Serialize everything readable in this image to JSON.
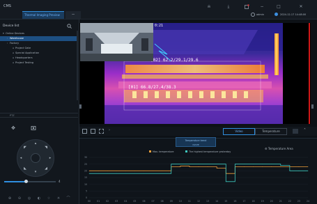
{
  "app": {
    "name": "CMS",
    "active_tab": "Thermal Imaging Preview",
    "tab_close": "−",
    "user": "admin",
    "datetime": "2024-12-17 14:48:00"
  },
  "toolbar_icons": [
    "bell-icon",
    "download-icon",
    "alert-icon",
    "minimize-icon",
    "maximize-icon",
    "settings-icon"
  ],
  "sidebar": {
    "title": "Device list",
    "items": [
      {
        "label": "Online Devices",
        "glyph": "▾",
        "selected": false,
        "indent": 1
      },
      {
        "label": "Warehouse",
        "glyph": "›",
        "selected": true,
        "indent": 2
      },
      {
        "label": "Factory",
        "glyph": "›",
        "selected": false,
        "indent": 2
      },
      {
        "label": "Project Gate",
        "glyph": "",
        "selected": false,
        "indent": 3
      },
      {
        "label": "Special Application",
        "glyph": "",
        "selected": false,
        "indent": 3
      },
      {
        "label": "Headquarters",
        "glyph": "",
        "selected": false,
        "indent": 3
      },
      {
        "label": "Project Testing",
        "glyph": "",
        "selected": false,
        "indent": 3
      }
    ]
  },
  "ptz": {
    "title": "PTZ",
    "speed": 4,
    "speed_fraction": 0.43
  },
  "video": {
    "timestamp": "0:21",
    "labels": [
      {
        "text": "[02] 62.2/29.1/29.6"
      },
      {
        "text": "[01] 66.8/27.4/38.3"
      }
    ]
  },
  "tabs": {
    "video": "Video",
    "temperature": "Temperature"
  },
  "chart_panel": {
    "title_line1": "Temperature trend",
    "title_line2": "curve",
    "export": "⚙ Temperature Area"
  },
  "colors": {
    "accent": "#2f8fe0",
    "max_temp": "#f2a03c",
    "highest_yesterday": "#3ec9c0"
  },
  "chart_data": {
    "type": "line",
    "title": "",
    "x": [
      "00",
      "01",
      "02",
      "03",
      "04",
      "05",
      "06",
      "07",
      "08",
      "09",
      "10",
      "11",
      "12",
      "13",
      "14",
      "15",
      "16",
      "17",
      "18",
      "19",
      "20",
      "21",
      "22",
      "23",
      "24"
    ],
    "ylim": [
      0,
      30
    ],
    "yticks": [
      0,
      5,
      10,
      15,
      20,
      25,
      30
    ],
    "series": [
      {
        "name": "Max. temperature",
        "color": "#f2a03c",
        "values": [
          20,
          20,
          20,
          20,
          20,
          20,
          20,
          20,
          20,
          23,
          23.5,
          23,
          23,
          23,
          22,
          18,
          23,
          23,
          23,
          23,
          23,
          23,
          23,
          23,
          23
        ]
      },
      {
        "name": "The highest temperature yesterday",
        "color": "#3ec9c0",
        "values": [
          18,
          18,
          18,
          18,
          18,
          18,
          18,
          18,
          18,
          25,
          25,
          25,
          25,
          25,
          25,
          12,
          25,
          25,
          25,
          25,
          25,
          24,
          20,
          20,
          20
        ]
      }
    ]
  }
}
